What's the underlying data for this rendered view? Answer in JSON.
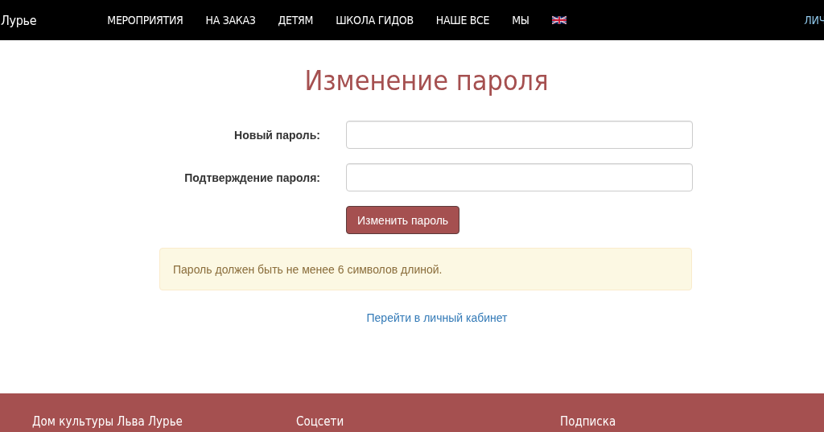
{
  "nav": {
    "logo": "Лурье",
    "items": [
      {
        "label": "МЕРОПРИЯТИЯ"
      },
      {
        "label": "НА ЗАКАЗ"
      },
      {
        "label": "ДЕТЯМ"
      },
      {
        "label": "ШКОЛА ГИДОВ"
      },
      {
        "label": "НАШЕ ВСЕ"
      },
      {
        "label": "МЫ"
      }
    ],
    "account": "ЛИЧ"
  },
  "title": "Изменение пароля",
  "fields": [
    {
      "label": "Новый пароль:"
    },
    {
      "label": "Подтверждение пароля:"
    }
  ],
  "submit": "Изменить пароль",
  "alert": "Пароль должен быть не менее 6 символов длиной.",
  "link": "Перейти в личный кабинет",
  "footer": [
    "Дом культуры Льва Лурье",
    "Соцсети",
    "Подписка"
  ]
}
